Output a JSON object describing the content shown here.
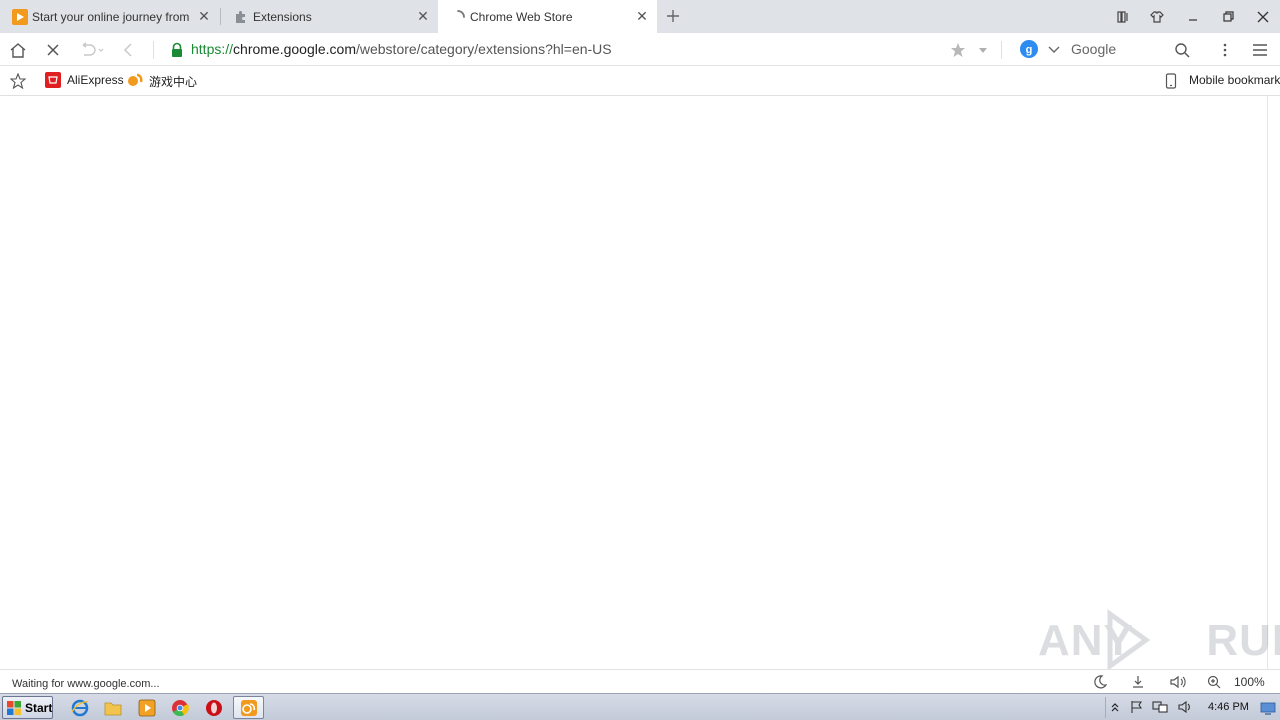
{
  "tabs": [
    {
      "title": "Start your online journey from he",
      "active": false
    },
    {
      "title": "Extensions",
      "active": false
    },
    {
      "title": "Chrome Web Store",
      "active": true
    }
  ],
  "toolbar": {
    "url_scheme": "https://",
    "url_host": "chrome.google.com",
    "url_path": "/webstore/category/extensions?hl=en-US",
    "search_engine": "Google"
  },
  "bookmarks": {
    "items": [
      {
        "label": "AliExpress"
      },
      {
        "label": "游戏中心"
      }
    ],
    "mobile_label": "Mobile bookmarks"
  },
  "status": {
    "text": "Waiting for www.google.com...",
    "zoom": "100%"
  },
  "watermark": {
    "text": "ANY RUN"
  },
  "taskbar": {
    "start_label": "Start",
    "clock": "4:46 PM"
  },
  "colors": {
    "accent_blue": "#2d8cf0",
    "secure_green": "#1a8a34",
    "aliexpress_red": "#e02020",
    "game_orange": "#f29a1d"
  }
}
